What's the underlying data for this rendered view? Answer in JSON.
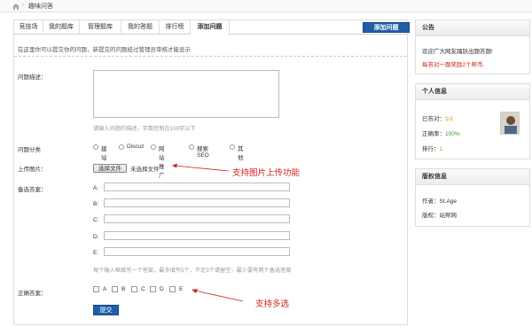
{
  "breadcrumb": {
    "home_icon": "home-icon",
    "current": "趣味问答"
  },
  "tabs": [
    "竞技场",
    "我的题库",
    "管理题库",
    "我的答题",
    "排行榜",
    "添加问题"
  ],
  "add_button": "添加问题",
  "intro": "在这里你可以提交你的问题，新提交的问题经过管理员审核才能显示",
  "form": {
    "desc_label": "问题描述：",
    "desc_hint": "请输入问题的描述，字数控制在100字以下",
    "category_label": "问题分类",
    "categories": [
      "建站",
      "Discuz",
      "网站推广",
      "搜索SEO",
      "其他"
    ],
    "upload_label": "上传图片：",
    "upload_button": "选择文件",
    "upload_none": "未选择文件",
    "upload_annotation": "支持图片上传功能",
    "answers_label": "备选答案：",
    "answer_letters": [
      "A:",
      "B:",
      "C:",
      "D:",
      "E:"
    ],
    "answers_hint": "每个输入框填写一个答案，最多填写5个，不足5个请留空，最少要有两个备选答案",
    "correct_label": "正确答案：",
    "correct_options": [
      "A",
      "B",
      "C",
      "D",
      "E"
    ],
    "correct_annotation": "支持多选",
    "submit": "提交"
  },
  "sidebar": {
    "notice": {
      "title": "公告",
      "line1": "欢迎广大网友踊跃出题答题!",
      "line2": "每答对一题奖励2个帮币."
    },
    "personal": {
      "title": "个人信息",
      "answered_label": "已答对：",
      "answered_value": "1/1",
      "accuracy_label": "正确率：",
      "accuracy_value": "100%",
      "rank_label": "排行：",
      "rank_value": "1"
    },
    "copyright": {
      "title": "版权信息",
      "author": "作者：St.Age",
      "copyright": "版权：站帮网"
    }
  },
  "colors": {
    "accent": "#1f5ea8",
    "annotation": "#d42020"
  }
}
